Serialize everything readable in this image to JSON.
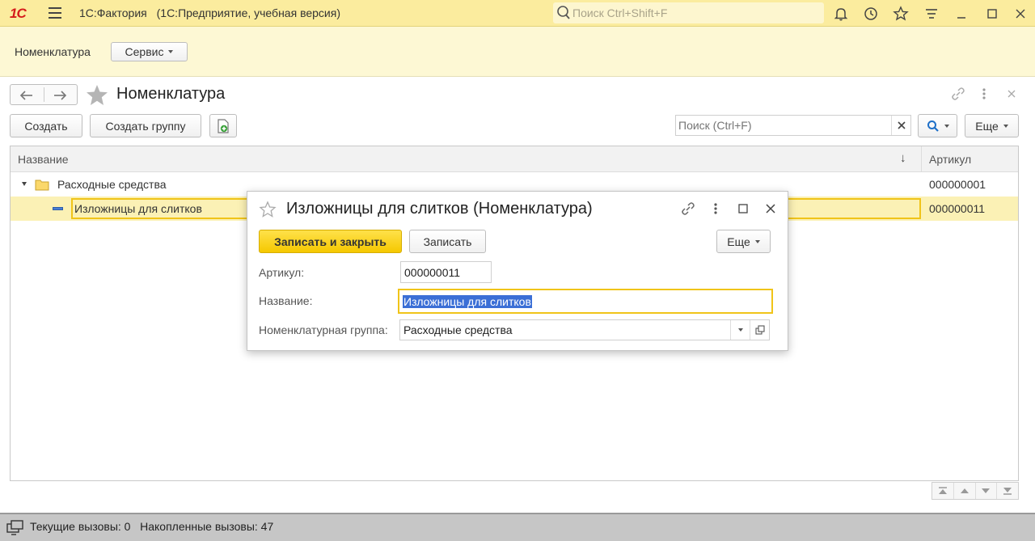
{
  "titlebar": {
    "logo": "1С",
    "app_name": "1С:Фактория",
    "app_sub": "(1С:Предприятие, учебная версия)",
    "search_placeholder": "Поиск Ctrl+Shift+F"
  },
  "section": {
    "nav_label": "Номенклатура",
    "service_label": "Сервис"
  },
  "form": {
    "title": "Номенклатура",
    "create_label": "Создать",
    "create_group_label": "Создать группу",
    "search_placeholder": "Поиск (Ctrl+F)",
    "more_label": "Еще"
  },
  "list": {
    "columns": [
      "Название",
      "Артикул"
    ],
    "rows": [
      {
        "name": "Расходные средства",
        "article": "000000001",
        "type": "group"
      },
      {
        "name": "Изложницы для слитков",
        "article": "000000011",
        "type": "item"
      }
    ]
  },
  "status": {
    "text": "Текущие вызовы: 0   Накопленные вызовы: 47"
  },
  "modal": {
    "title": "Изложницы для слитков (Номенклатура)",
    "save_close_label": "Записать и закрыть",
    "save_label": "Записать",
    "more_label": "Еще",
    "article_label": "Артикул:",
    "article_value": "000000011",
    "name_label": "Название:",
    "name_value": "Изложницы для слитков",
    "group_label": "Номенклатурная группа:",
    "group_value": "Расходные средства"
  },
  "colors": {
    "titlebar_bg": "#fbec9e",
    "accent_yellow": "#f0c419",
    "selection_bg": "#fbf1b5",
    "logo_red": "#d51c1c"
  }
}
